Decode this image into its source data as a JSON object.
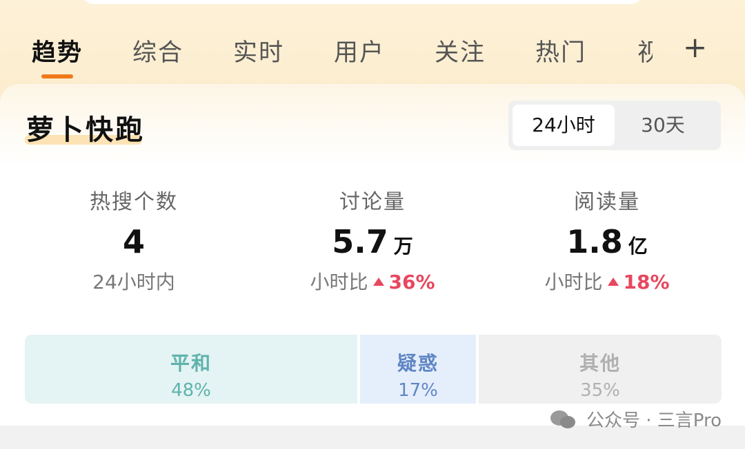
{
  "tabs": [
    {
      "label": "趋势"
    },
    {
      "label": "综合"
    },
    {
      "label": "实时"
    },
    {
      "label": "用户"
    },
    {
      "label": "关注"
    },
    {
      "label": "热门"
    },
    {
      "label": "视"
    }
  ],
  "topic": {
    "title": "萝卜快跑"
  },
  "range_toggle": {
    "option_24h": "24小时",
    "option_30d": "30天",
    "selected": "24小时"
  },
  "stats": {
    "hot_search": {
      "label": "热搜个数",
      "value": "4",
      "sub": "24小时内"
    },
    "discussion": {
      "label": "讨论量",
      "value": "5.7",
      "unit": "万",
      "sub_prefix": "小时比",
      "change": "36%"
    },
    "reads": {
      "label": "阅读量",
      "value": "1.8",
      "unit": "亿",
      "sub_prefix": "小时比",
      "change": "18%"
    }
  },
  "sentiment": [
    {
      "name": "平和",
      "value": "48%",
      "color": "#5fb3ad"
    },
    {
      "name": "疑惑",
      "value": "17%",
      "color": "#5f86c4"
    },
    {
      "name": "其他",
      "value": "35%",
      "color": "#b0b0b0"
    }
  ],
  "watermark": {
    "text": "公众号 · 三言Pro"
  },
  "icons": {
    "plus": "plus-icon",
    "up": "triangle-up-icon",
    "wechat": "wechat-icon"
  }
}
